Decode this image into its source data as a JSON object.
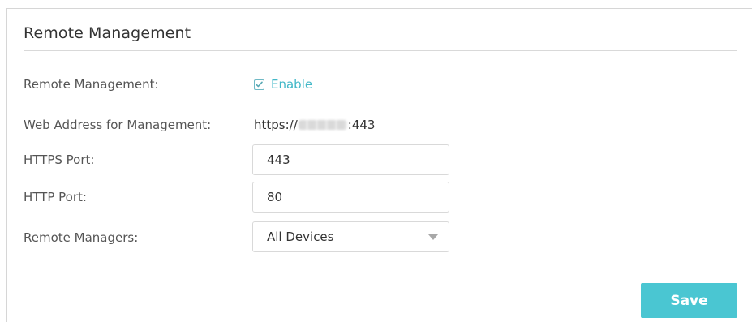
{
  "section": {
    "title": "Remote Management"
  },
  "form": {
    "remote_management": {
      "label": "Remote Management:",
      "checkbox_label": "Enable",
      "checked": true
    },
    "web_address": {
      "label": "Web Address for Management:",
      "prefix": "https://",
      "suffix": ":443"
    },
    "https_port": {
      "label": "HTTPS Port:",
      "value": "443"
    },
    "http_port": {
      "label": "HTTP Port:",
      "value": "80"
    },
    "remote_managers": {
      "label": "Remote Managers:",
      "selected": "All Devices"
    }
  },
  "actions": {
    "save_label": "Save"
  },
  "colors": {
    "accent": "#4ac6d2",
    "link": "#43b8c8"
  }
}
